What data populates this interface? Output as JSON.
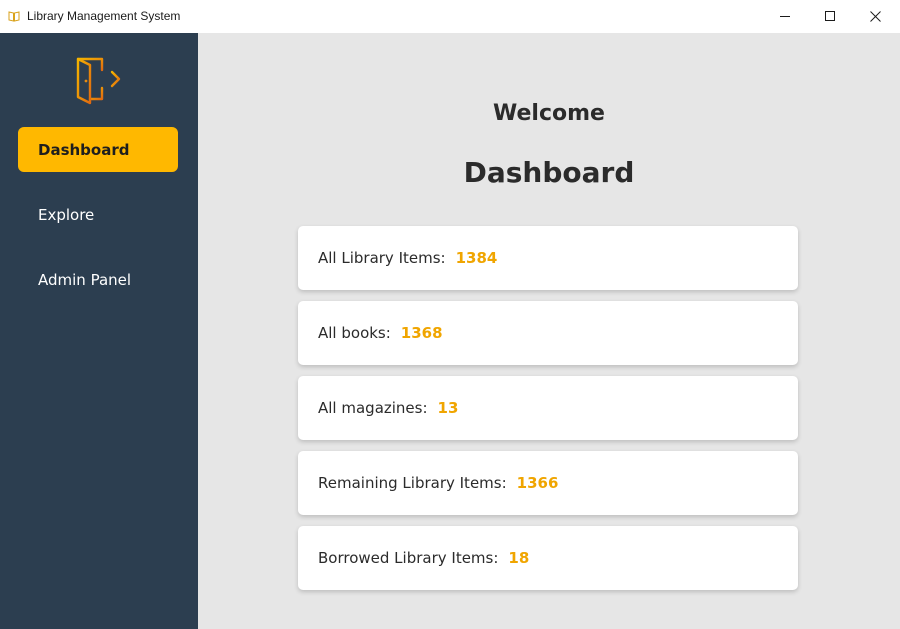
{
  "window": {
    "title": "Library Management System",
    "icon": "book-icon"
  },
  "colors": {
    "sidebar": "#2c3e50",
    "accent": "#ffb800",
    "value": "#f0a500",
    "main_bg": "#e6e6e6"
  },
  "sidebar": {
    "logo_icon": "logout-door-icon",
    "items": [
      {
        "label": "Dashboard",
        "active": true
      },
      {
        "label": "Explore",
        "active": false
      },
      {
        "label": "Admin Panel",
        "active": false
      }
    ]
  },
  "main": {
    "welcome": "Welcome",
    "title": "Dashboard",
    "stats": [
      {
        "label": "All Library Items:",
        "value": "1384"
      },
      {
        "label": "All books:",
        "value": "1368"
      },
      {
        "label": "All magazines:",
        "value": "13"
      },
      {
        "label": "Remaining Library Items:",
        "value": "1366"
      },
      {
        "label": "Borrowed Library Items:",
        "value": "18"
      }
    ]
  }
}
